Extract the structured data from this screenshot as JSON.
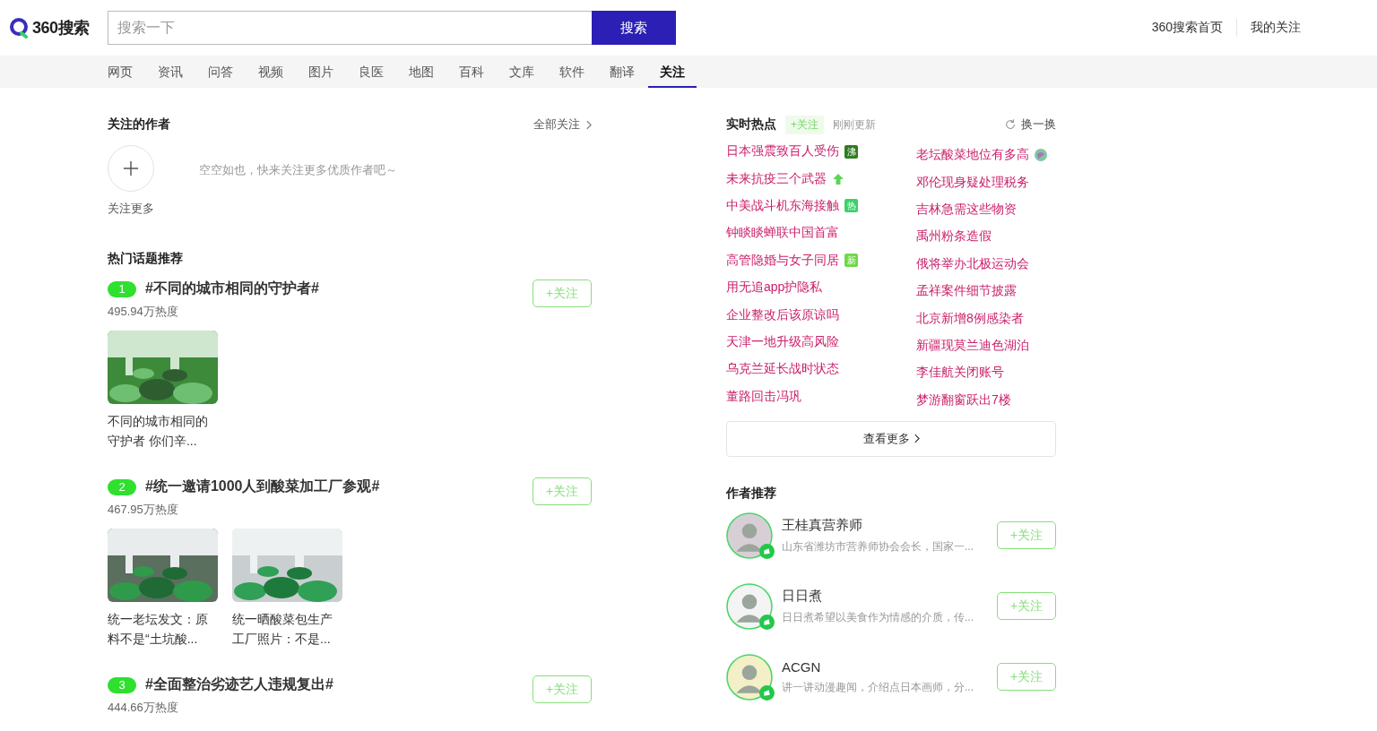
{
  "header": {
    "logo": "360搜索",
    "search": {
      "placeholder": "搜索一下"
    },
    "search_button": "搜索",
    "links": [
      "360搜索首页",
      "我的关注"
    ]
  },
  "tabs": [
    {
      "label": "网页",
      "selected": false
    },
    {
      "label": "资讯",
      "selected": false
    },
    {
      "label": "问答",
      "selected": false
    },
    {
      "label": "视频",
      "selected": false
    },
    {
      "label": "图片",
      "selected": false
    },
    {
      "label": "良医",
      "selected": false
    },
    {
      "label": "地图",
      "selected": false
    },
    {
      "label": "百科",
      "selected": false
    },
    {
      "label": "文库",
      "selected": false
    },
    {
      "label": "软件",
      "selected": false
    },
    {
      "label": "翻译",
      "selected": false
    },
    {
      "label": "关注",
      "selected": true
    }
  ],
  "followed_authors": {
    "title": "关注的作者",
    "all_link": "全部关注",
    "add_label": "关注更多",
    "empty_text": "空空如也，快来关注更多优质作者吧～"
  },
  "hot_topics": {
    "title": "热门话题推荐",
    "items": [
      {
        "rank": "1",
        "title": "#不同的城市相同的守护者#",
        "heat": "495.94万热度",
        "follow": "+关注",
        "articles": [
          {
            "kind": "picture",
            "caption": "不同的城市相同的守护者 你们辛..."
          }
        ]
      },
      {
        "rank": "2",
        "title": "#统一邀请1000人到酸菜加工厂参观#",
        "heat": "467.95万热度",
        "follow": "+关注",
        "articles": [
          {
            "kind": "picture",
            "caption": "统一老坛发文：原料不是“土坑酸..."
          },
          {
            "kind": "picture",
            "caption": "统一晒酸菜包生产工厂照片：不是..."
          }
        ]
      },
      {
        "rank": "3",
        "title": "#全面整治劣迹艺人违规复出#",
        "heat": "444.66万热度",
        "follow": "+关注"
      }
    ]
  },
  "realtime": {
    "title": "实时热点",
    "follow": "+关注",
    "updated": "刚刚更新",
    "refresh": "换一换",
    "more": "查看更多",
    "columns": [
      [
        {
          "text": "日本强震致百人受伤",
          "badge": {
            "kind": "label",
            "text": "沸",
            "color": "#2f7d1e"
          }
        },
        {
          "text": "未来抗疫三个武器",
          "badge": {
            "kind": "up",
            "color": "#5fd35a"
          }
        },
        {
          "text": "中美战斗机东海接触",
          "badge": {
            "kind": "label",
            "text": "热",
            "color": "#3ed06a"
          }
        },
        {
          "text": "钟睒睒蝉联中国首富"
        },
        {
          "text": "高管隐婚与女子同居",
          "badge": {
            "kind": "label",
            "text": "新",
            "color": "#6fd84a"
          }
        },
        {
          "text": "用无追app护隐私"
        },
        {
          "text": "企业整改后该原谅吗"
        },
        {
          "text": "天津一地升级高风险"
        },
        {
          "text": "乌克兰延长战时状态"
        },
        {
          "text": "董路回击冯巩"
        }
      ],
      [
        {
          "text": "老坛酸菜地位有多高",
          "badge": {
            "kind": "dot",
            "color": "#7fc8a0"
          }
        },
        {
          "text": "邓伦现身疑处理税务"
        },
        {
          "text": "吉林急需这些物资"
        },
        {
          "text": "禹州粉条造假"
        },
        {
          "text": "俄将举办北极运动会"
        },
        {
          "text": "孟祥案件细节披露"
        },
        {
          "text": "北京新增8例感染者"
        },
        {
          "text": "新疆现莫兰迪色湖泊"
        },
        {
          "text": "李佳航关闭账号"
        },
        {
          "text": "梦游翻窗跃出7楼"
        }
      ]
    ]
  },
  "recommended_authors": {
    "title": "作者推荐",
    "items": [
      {
        "name": "王桂真营养师",
        "description": "山东省潍坊市营养师协会会长，国家一...",
        "follow": "+关注",
        "verified": true
      },
      {
        "name": "日日煮",
        "description": "日日煮希望以美食作为情感的介质，传...",
        "follow": "+关注",
        "verified": true
      },
      {
        "name": "ACGN",
        "description": "讲一讲动漫趣闻，介绍点日本画师，分...",
        "follow": "+关注",
        "verified": true
      }
    ]
  }
}
